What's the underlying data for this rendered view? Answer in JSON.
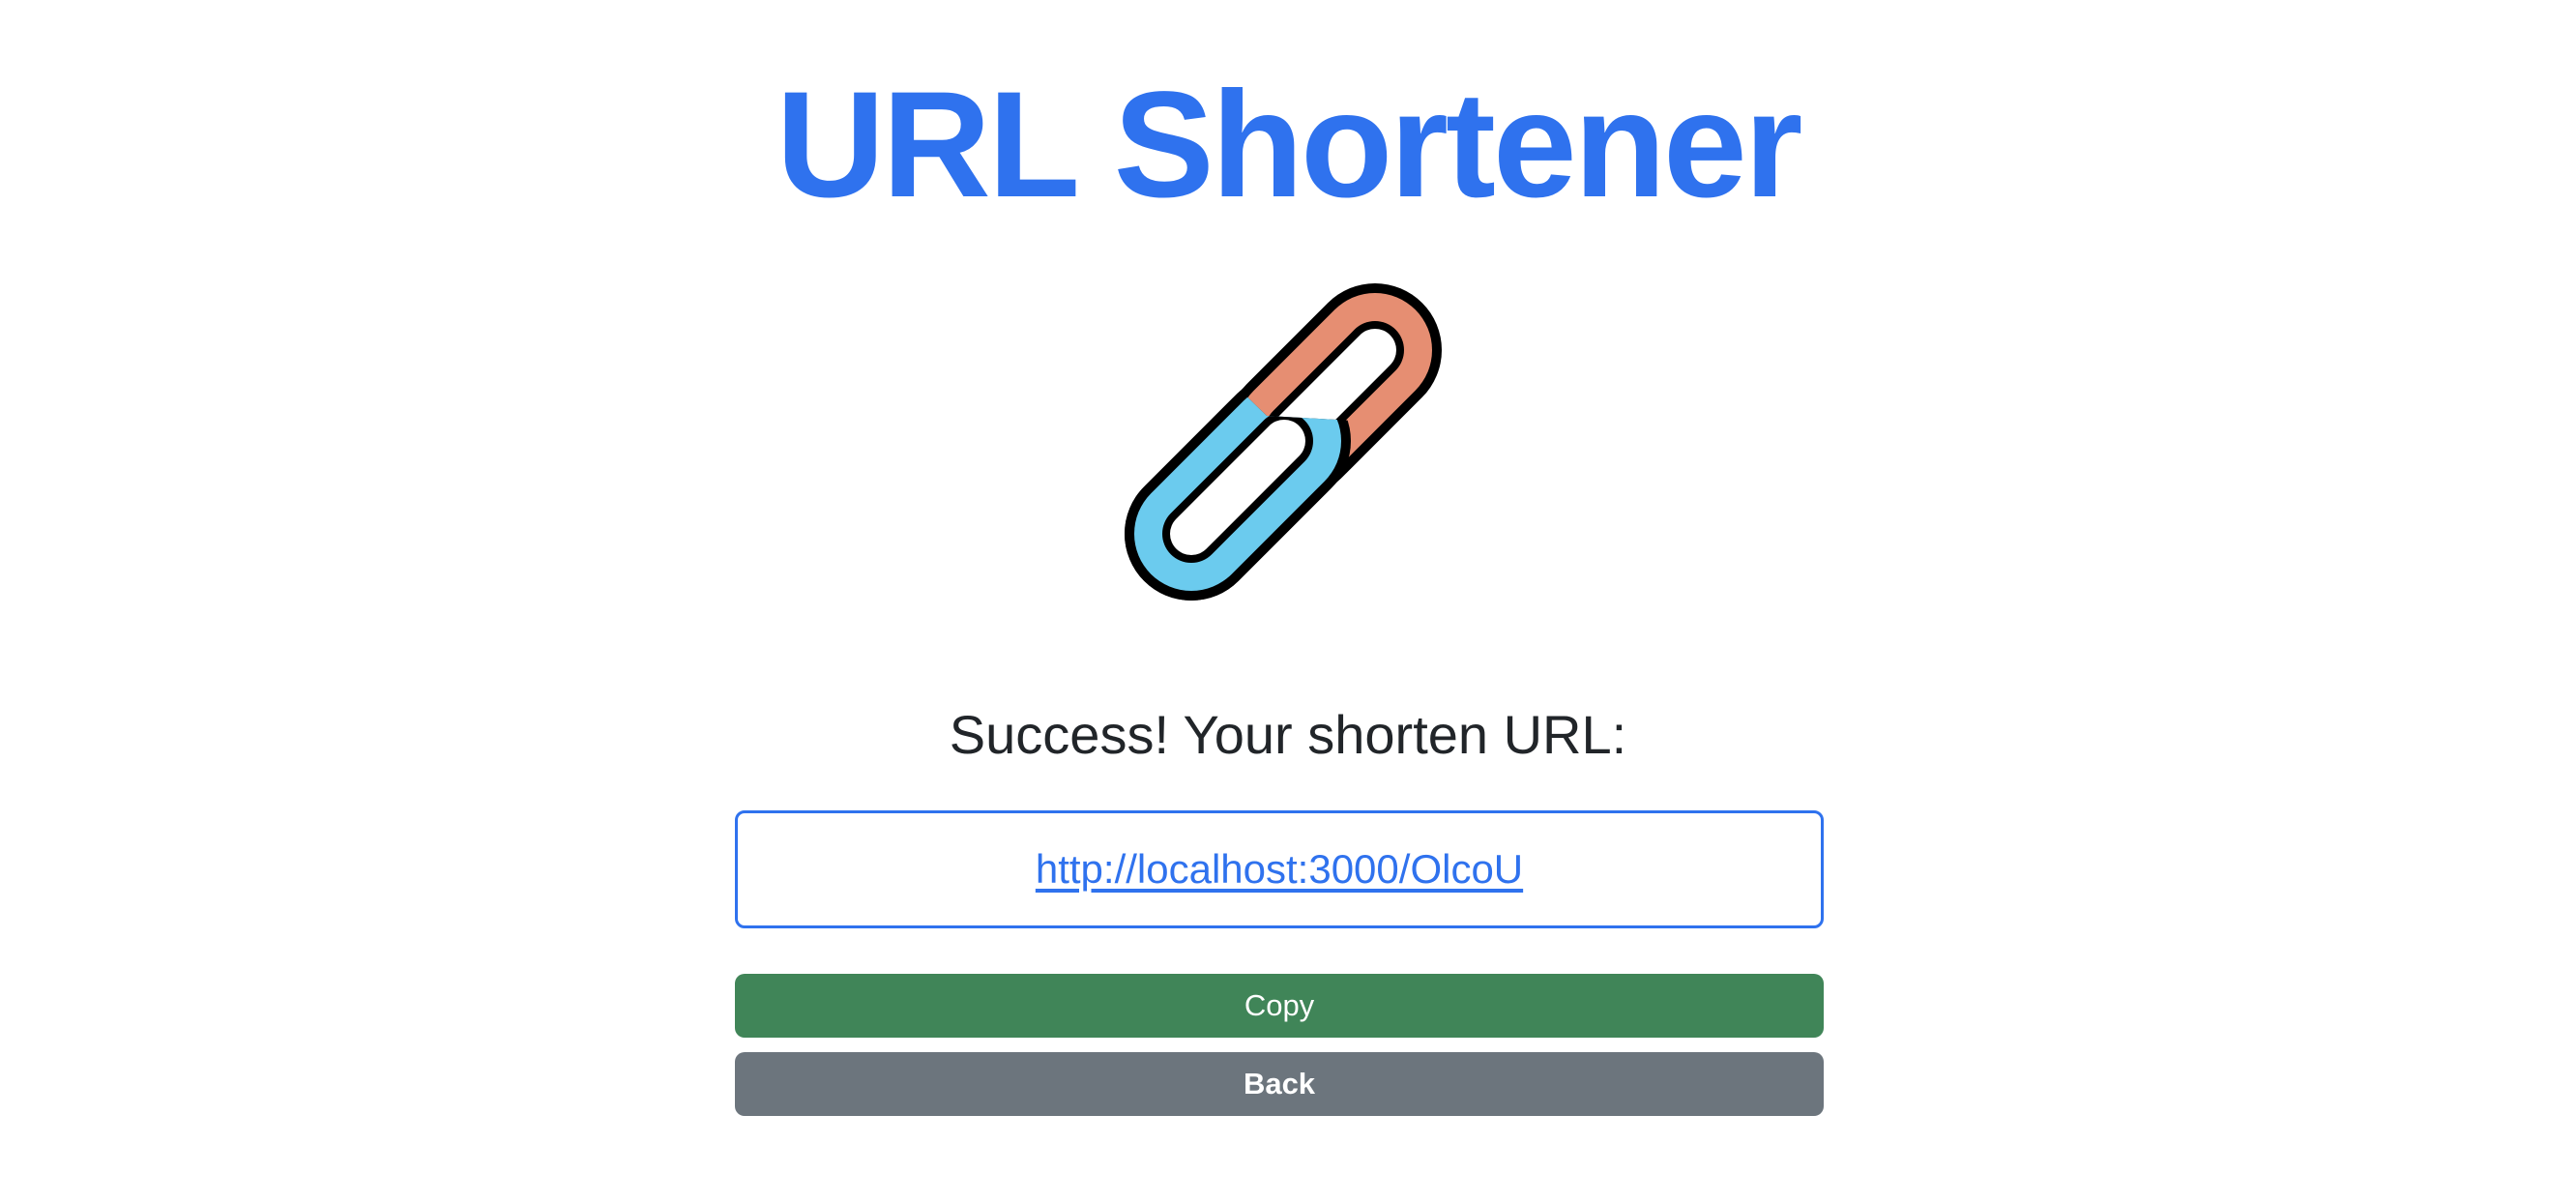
{
  "header": {
    "title": "URL Shortener"
  },
  "logo": {
    "icon": "chain-link-icon"
  },
  "result": {
    "message": "Success! Your shorten URL:",
    "short_url": "http://localhost:3000/OlcoU"
  },
  "actions": {
    "copy_label": "Copy",
    "back_label": "Back"
  },
  "colors": {
    "title": "#2f72ee",
    "link": "#2f72ee",
    "url_box_border": "#2f72ee",
    "copy_button": "#408558",
    "back_button": "#6c757d",
    "link_left": "#6bcbee",
    "link_right": "#e68e72"
  }
}
